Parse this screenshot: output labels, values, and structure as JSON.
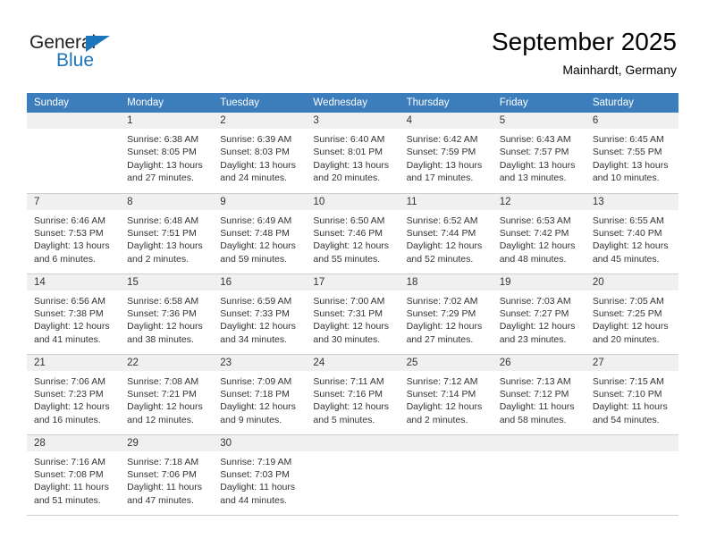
{
  "brand": {
    "name_part1": "General",
    "name_part2": "Blue",
    "triangle_color": "#1b75bb",
    "text_color": "#231f20"
  },
  "header": {
    "title": "September 2025",
    "subtitle": "Mainhardt, Germany"
  },
  "colors": {
    "header_row_bg": "#3c7ebc",
    "header_row_text": "#ffffff",
    "daynum_band_bg": "#f0f0f0",
    "cell_text": "#333333",
    "grid_line": "#cfcfcf"
  },
  "weekdays": [
    "Sunday",
    "Monday",
    "Tuesday",
    "Wednesday",
    "Thursday",
    "Friday",
    "Saturday"
  ],
  "labels": {
    "sunrise_prefix": "Sunrise:",
    "sunset_prefix": "Sunset:",
    "daylight_prefix": "Daylight:"
  },
  "weeks": [
    [
      {
        "day": "",
        "empty": true,
        "line1": "",
        "line2": "",
        "line3": "",
        "line4": ""
      },
      {
        "day": "1",
        "line1": "Sunrise: 6:38 AM",
        "line2": "Sunset: 8:05 PM",
        "line3": "Daylight: 13 hours",
        "line4": "and 27 minutes."
      },
      {
        "day": "2",
        "line1": "Sunrise: 6:39 AM",
        "line2": "Sunset: 8:03 PM",
        "line3": "Daylight: 13 hours",
        "line4": "and 24 minutes."
      },
      {
        "day": "3",
        "line1": "Sunrise: 6:40 AM",
        "line2": "Sunset: 8:01 PM",
        "line3": "Daylight: 13 hours",
        "line4": "and 20 minutes."
      },
      {
        "day": "4",
        "line1": "Sunrise: 6:42 AM",
        "line2": "Sunset: 7:59 PM",
        "line3": "Daylight: 13 hours",
        "line4": "and 17 minutes."
      },
      {
        "day": "5",
        "line1": "Sunrise: 6:43 AM",
        "line2": "Sunset: 7:57 PM",
        "line3": "Daylight: 13 hours",
        "line4": "and 13 minutes."
      },
      {
        "day": "6",
        "line1": "Sunrise: 6:45 AM",
        "line2": "Sunset: 7:55 PM",
        "line3": "Daylight: 13 hours",
        "line4": "and 10 minutes."
      }
    ],
    [
      {
        "day": "7",
        "line1": "Sunrise: 6:46 AM",
        "line2": "Sunset: 7:53 PM",
        "line3": "Daylight: 13 hours",
        "line4": "and 6 minutes."
      },
      {
        "day": "8",
        "line1": "Sunrise: 6:48 AM",
        "line2": "Sunset: 7:51 PM",
        "line3": "Daylight: 13 hours",
        "line4": "and 2 minutes."
      },
      {
        "day": "9",
        "line1": "Sunrise: 6:49 AM",
        "line2": "Sunset: 7:48 PM",
        "line3": "Daylight: 12 hours",
        "line4": "and 59 minutes."
      },
      {
        "day": "10",
        "line1": "Sunrise: 6:50 AM",
        "line2": "Sunset: 7:46 PM",
        "line3": "Daylight: 12 hours",
        "line4": "and 55 minutes."
      },
      {
        "day": "11",
        "line1": "Sunrise: 6:52 AM",
        "line2": "Sunset: 7:44 PM",
        "line3": "Daylight: 12 hours",
        "line4": "and 52 minutes."
      },
      {
        "day": "12",
        "line1": "Sunrise: 6:53 AM",
        "line2": "Sunset: 7:42 PM",
        "line3": "Daylight: 12 hours",
        "line4": "and 48 minutes."
      },
      {
        "day": "13",
        "line1": "Sunrise: 6:55 AM",
        "line2": "Sunset: 7:40 PM",
        "line3": "Daylight: 12 hours",
        "line4": "and 45 minutes."
      }
    ],
    [
      {
        "day": "14",
        "line1": "Sunrise: 6:56 AM",
        "line2": "Sunset: 7:38 PM",
        "line3": "Daylight: 12 hours",
        "line4": "and 41 minutes."
      },
      {
        "day": "15",
        "line1": "Sunrise: 6:58 AM",
        "line2": "Sunset: 7:36 PM",
        "line3": "Daylight: 12 hours",
        "line4": "and 38 minutes."
      },
      {
        "day": "16",
        "line1": "Sunrise: 6:59 AM",
        "line2": "Sunset: 7:33 PM",
        "line3": "Daylight: 12 hours",
        "line4": "and 34 minutes."
      },
      {
        "day": "17",
        "line1": "Sunrise: 7:00 AM",
        "line2": "Sunset: 7:31 PM",
        "line3": "Daylight: 12 hours",
        "line4": "and 30 minutes."
      },
      {
        "day": "18",
        "line1": "Sunrise: 7:02 AM",
        "line2": "Sunset: 7:29 PM",
        "line3": "Daylight: 12 hours",
        "line4": "and 27 minutes."
      },
      {
        "day": "19",
        "line1": "Sunrise: 7:03 AM",
        "line2": "Sunset: 7:27 PM",
        "line3": "Daylight: 12 hours",
        "line4": "and 23 minutes."
      },
      {
        "day": "20",
        "line1": "Sunrise: 7:05 AM",
        "line2": "Sunset: 7:25 PM",
        "line3": "Daylight: 12 hours",
        "line4": "and 20 minutes."
      }
    ],
    [
      {
        "day": "21",
        "line1": "Sunrise: 7:06 AM",
        "line2": "Sunset: 7:23 PM",
        "line3": "Daylight: 12 hours",
        "line4": "and 16 minutes."
      },
      {
        "day": "22",
        "line1": "Sunrise: 7:08 AM",
        "line2": "Sunset: 7:21 PM",
        "line3": "Daylight: 12 hours",
        "line4": "and 12 minutes."
      },
      {
        "day": "23",
        "line1": "Sunrise: 7:09 AM",
        "line2": "Sunset: 7:18 PM",
        "line3": "Daylight: 12 hours",
        "line4": "and 9 minutes."
      },
      {
        "day": "24",
        "line1": "Sunrise: 7:11 AM",
        "line2": "Sunset: 7:16 PM",
        "line3": "Daylight: 12 hours",
        "line4": "and 5 minutes."
      },
      {
        "day": "25",
        "line1": "Sunrise: 7:12 AM",
        "line2": "Sunset: 7:14 PM",
        "line3": "Daylight: 12 hours",
        "line4": "and 2 minutes."
      },
      {
        "day": "26",
        "line1": "Sunrise: 7:13 AM",
        "line2": "Sunset: 7:12 PM",
        "line3": "Daylight: 11 hours",
        "line4": "and 58 minutes."
      },
      {
        "day": "27",
        "line1": "Sunrise: 7:15 AM",
        "line2": "Sunset: 7:10 PM",
        "line3": "Daylight: 11 hours",
        "line4": "and 54 minutes."
      }
    ],
    [
      {
        "day": "28",
        "line1": "Sunrise: 7:16 AM",
        "line2": "Sunset: 7:08 PM",
        "line3": "Daylight: 11 hours",
        "line4": "and 51 minutes."
      },
      {
        "day": "29",
        "line1": "Sunrise: 7:18 AM",
        "line2": "Sunset: 7:06 PM",
        "line3": "Daylight: 11 hours",
        "line4": "and 47 minutes."
      },
      {
        "day": "30",
        "line1": "Sunrise: 7:19 AM",
        "line2": "Sunset: 7:03 PM",
        "line3": "Daylight: 11 hours",
        "line4": "and 44 minutes."
      },
      {
        "day": "",
        "empty": true,
        "line1": "",
        "line2": "",
        "line3": "",
        "line4": ""
      },
      {
        "day": "",
        "empty": true,
        "line1": "",
        "line2": "",
        "line3": "",
        "line4": ""
      },
      {
        "day": "",
        "empty": true,
        "line1": "",
        "line2": "",
        "line3": "",
        "line4": ""
      },
      {
        "day": "",
        "empty": true,
        "line1": "",
        "line2": "",
        "line3": "",
        "line4": ""
      }
    ]
  ]
}
